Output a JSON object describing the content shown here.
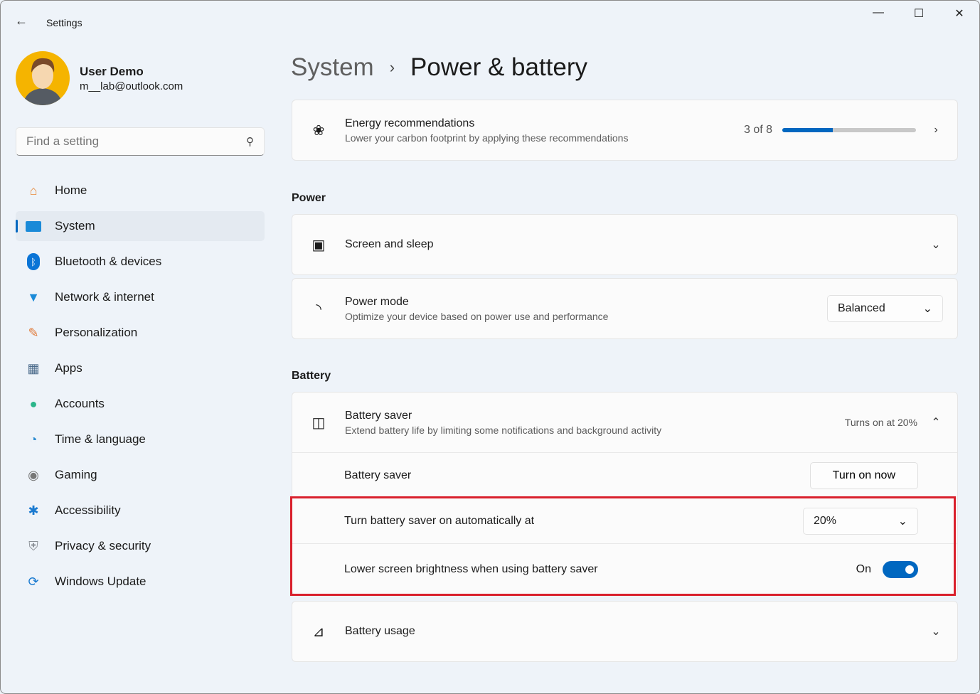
{
  "window": {
    "title": "Settings"
  },
  "user": {
    "name": "User Demo",
    "email": "m__lab@outlook.com"
  },
  "search": {
    "placeholder": "Find a setting"
  },
  "nav": [
    {
      "label": "Home",
      "icon": "home-icon"
    },
    {
      "label": "System",
      "icon": "system-icon",
      "selected": true
    },
    {
      "label": "Bluetooth & devices",
      "icon": "bluetooth-icon"
    },
    {
      "label": "Network & internet",
      "icon": "wifi-icon"
    },
    {
      "label": "Personalization",
      "icon": "brush-icon"
    },
    {
      "label": "Apps",
      "icon": "apps-icon"
    },
    {
      "label": "Accounts",
      "icon": "person-icon"
    },
    {
      "label": "Time & language",
      "icon": "clock-globe-icon"
    },
    {
      "label": "Gaming",
      "icon": "gamepad-icon"
    },
    {
      "label": "Accessibility",
      "icon": "accessibility-icon"
    },
    {
      "label": "Privacy & security",
      "icon": "shield-icon"
    },
    {
      "label": "Windows Update",
      "icon": "update-icon"
    }
  ],
  "breadcrumb": {
    "parent": "System",
    "current": "Power & battery"
  },
  "energy": {
    "title": "Energy recommendations",
    "desc": "Lower your carbon footprint by applying these recommendations",
    "count": "3 of 8",
    "progress_fraction": 0.375
  },
  "power": {
    "heading": "Power",
    "screen_sleep": "Screen and sleep",
    "mode_title": "Power mode",
    "mode_desc": "Optimize your device based on power use and performance",
    "mode_value": "Balanced"
  },
  "battery": {
    "heading": "Battery",
    "saver_title": "Battery saver",
    "saver_desc": "Extend battery life by limiting some notifications and background activity",
    "saver_status": "Turns on at 20%",
    "saver_row": "Battery saver",
    "turn_on": "Turn on now",
    "auto_label": "Turn battery saver on automatically at",
    "auto_value": "20%",
    "brightness_label": "Lower screen brightness when using battery saver",
    "brightness_state": "On",
    "usage": "Battery usage"
  },
  "colors": {
    "accent": "#0067c0",
    "highlight": "#d9202c"
  }
}
